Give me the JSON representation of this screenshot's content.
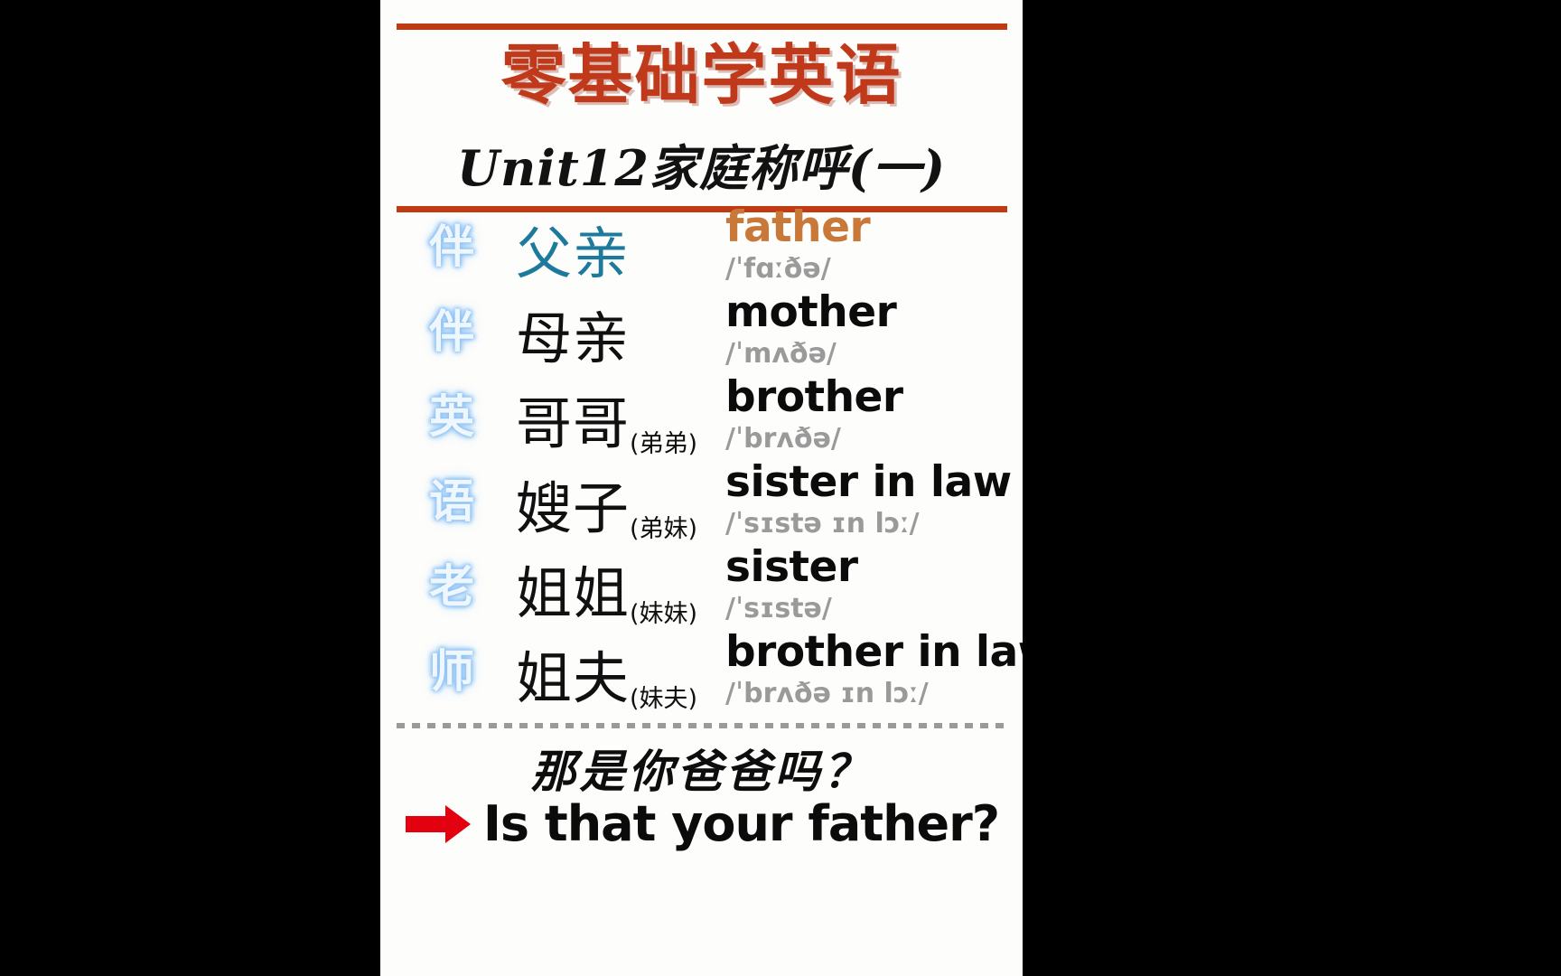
{
  "header": {
    "title": "零基础学英语",
    "subtitle": "Unit12家庭称呼(一)",
    "title_color": "#c0391a",
    "rule_color": "#c03a12"
  },
  "watermark": {
    "text": "伴伴英语老师",
    "chars": [
      "伴",
      "伴",
      "英",
      "语",
      "老",
      "师"
    ],
    "color": "#aad3f7"
  },
  "vocabulary": [
    {
      "mark": "伴",
      "chinese": "父亲",
      "note": "",
      "english": "father",
      "ipa": "/ˈfɑːðə/",
      "highlight": true
    },
    {
      "mark": "伴",
      "chinese": "母亲",
      "note": "",
      "english": "mother",
      "ipa": "/ˈmʌðə/",
      "highlight": false
    },
    {
      "mark": "英",
      "chinese": "哥哥",
      "note": "(弟弟)",
      "english": "brother",
      "ipa": "/ˈbrʌðə/",
      "highlight": false
    },
    {
      "mark": "语",
      "chinese": "嫂子",
      "note": "(弟妹)",
      "english": "sister in law",
      "ipa": "/ˈsɪstə ɪn lɔː/",
      "highlight": false
    },
    {
      "mark": "老",
      "chinese": "姐姐",
      "note": "(妹妹)",
      "english": "sister",
      "ipa": "/ˈsɪstə/",
      "highlight": false
    },
    {
      "mark": "师",
      "chinese": "姐夫",
      "note": "(妹夫)",
      "english": "brother in law",
      "ipa": "/ˈbrʌðə ɪn lɔː/",
      "highlight": false
    }
  ],
  "example": {
    "chinese": "那是你爸爸吗？",
    "english": "Is that your father?",
    "arrow_color": "#e3000f"
  }
}
